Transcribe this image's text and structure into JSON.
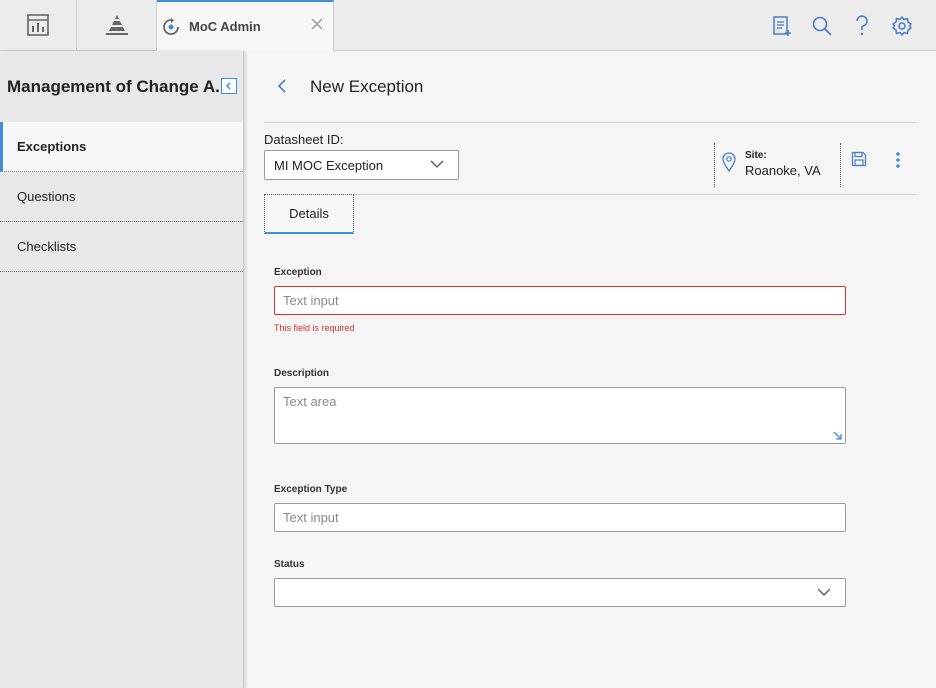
{
  "topbar": {
    "tab": {
      "label": "MoC Admin"
    },
    "icons": [
      "dashboard-icon",
      "pyramid-icon",
      "new-document-icon",
      "search-icon",
      "help-icon",
      "settings-icon"
    ]
  },
  "sidebar": {
    "title": "Management of Change A...",
    "items": [
      {
        "label": "Exceptions",
        "active": true
      },
      {
        "label": "Questions",
        "active": false
      },
      {
        "label": "Checklists",
        "active": false
      }
    ]
  },
  "header": {
    "title": "New Exception"
  },
  "datasheet": {
    "label": "Datasheet ID:",
    "value": "MI MOC Exception"
  },
  "site": {
    "label": "Site:",
    "value": "Roanoke, VA"
  },
  "tabs": [
    {
      "label": "Details"
    }
  ],
  "form": {
    "exception": {
      "label": "Exception",
      "placeholder": "Text input",
      "error": "This field is required"
    },
    "description": {
      "label": "Description",
      "placeholder": "Text area"
    },
    "exception_type": {
      "label": "Exception Type",
      "placeholder": "Text input"
    },
    "status": {
      "label": "Status",
      "value": ""
    }
  },
  "colors": {
    "accent": "#3f8edc",
    "error": "#d9302c"
  }
}
